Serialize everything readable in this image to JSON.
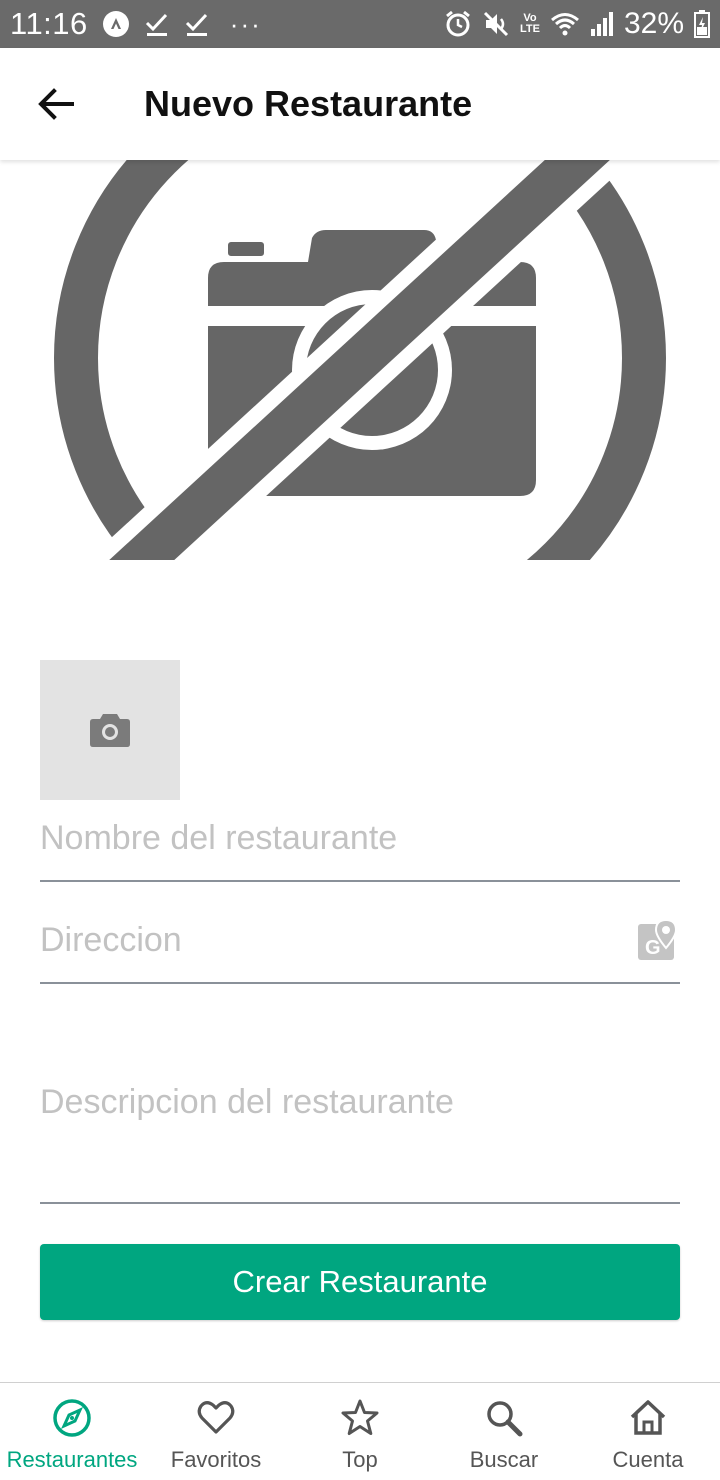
{
  "status_bar": {
    "time": "11:16",
    "battery": "32%",
    "lte_top": "Vo",
    "lte_bottom": "LTE",
    "icons": [
      "app-a-icon",
      "check-icon",
      "check-icon",
      "more-dots-icon",
      "alarm-icon",
      "mute-icon",
      "volte-icon",
      "wifi-icon",
      "signal-icon",
      "battery-icon"
    ]
  },
  "app_bar": {
    "title": "Nuevo Restaurante",
    "back_icon": "arrow-left-icon"
  },
  "hero": {
    "icon": "no-photo-icon"
  },
  "form": {
    "name_placeholder": "Nombre del restaurante",
    "address_placeholder": "Direccion",
    "address_icon": "google-maps-icon",
    "description_placeholder": "Descripcion del restaurante",
    "add_photo_icon": "camera-icon",
    "submit_label": "Crear Restaurante"
  },
  "bottom_nav": {
    "items": [
      {
        "label": "Restaurantes",
        "icon": "compass-icon",
        "active": true
      },
      {
        "label": "Favoritos",
        "icon": "heart-icon",
        "active": false
      },
      {
        "label": "Top",
        "icon": "star-icon",
        "active": false
      },
      {
        "label": "Buscar",
        "icon": "search-icon",
        "active": false
      },
      {
        "label": "Cuenta",
        "icon": "home-icon",
        "active": false
      }
    ]
  },
  "colors": {
    "accent": "#00a680",
    "status_bar": "#6a6a6a",
    "icon_gray": "#666666",
    "thumb_bg": "#e3e3e3"
  }
}
